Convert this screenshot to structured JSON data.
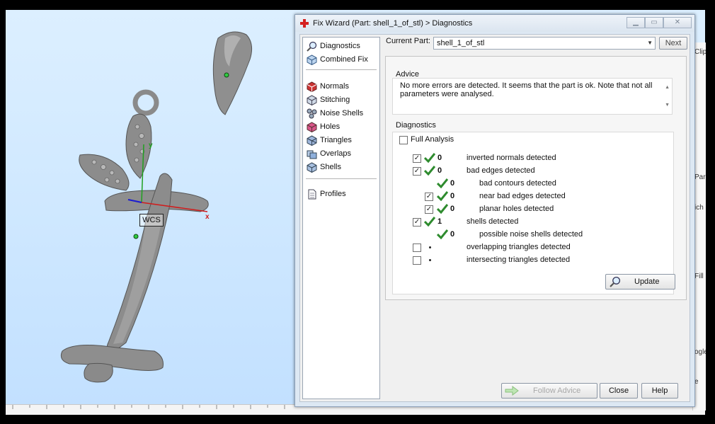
{
  "dialog": {
    "title": "Fix Wizard (Part: shell_1_of_stl) > Diagnostics",
    "current_part_label": "Current Part:",
    "current_part_value": "shell_1_of_stl",
    "next_label": "Next",
    "follow_advice_label": "Follow Advice",
    "close_label": "Close",
    "help_label": "Help"
  },
  "nav": {
    "top": [
      "Diagnostics",
      "Combined Fix"
    ],
    "middle": [
      "Normals",
      "Stitching",
      "Noise Shells",
      "Holes",
      "Triangles",
      "Overlaps",
      "Shells"
    ],
    "bottom": [
      "Profiles"
    ]
  },
  "advice": {
    "title": "Advice",
    "text": "No more errors are detected. It seems that the part is ok. Note that not all parameters were analysed."
  },
  "diagnostics": {
    "title": "Diagnostics",
    "full_analysis_label": "Full Analysis",
    "update_label": "Update",
    "rows": [
      {
        "count": "0",
        "label": "inverted normals detected"
      },
      {
        "count": "0",
        "label": "bad edges detected"
      },
      {
        "count": "0",
        "label": "bad contours detected"
      },
      {
        "count": "0",
        "label": "near bad edges detected"
      },
      {
        "count": "0",
        "label": "planar holes detected"
      },
      {
        "count": "1",
        "label": "shells detected"
      },
      {
        "count": "0",
        "label": "possible noise shells detected"
      },
      {
        "count": "",
        "label": "overlapping triangles detected"
      },
      {
        "count": "",
        "label": "intersecting triangles detected"
      }
    ]
  },
  "viewport": {
    "wcs_label": "WCS",
    "axis_x": "x",
    "axis_y": "y"
  },
  "right_panel": {
    "clip": "Clip",
    "par": "Par",
    "sch": "ich",
    "fill": "Fill",
    "ogle": "ogle",
    "e": "e"
  },
  "colors": {
    "accent_check": "#2e8b2e",
    "title_cross": "#d42020",
    "viewport_bg": "#cfe8ff"
  }
}
